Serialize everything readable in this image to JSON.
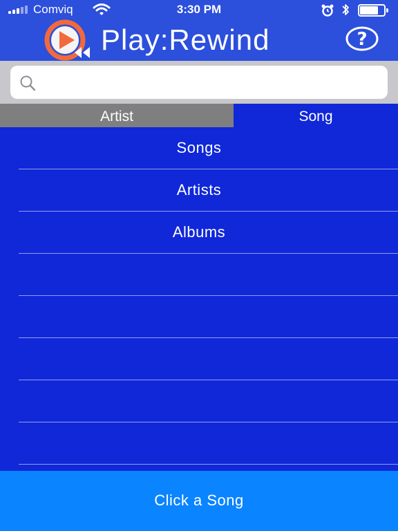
{
  "status_bar": {
    "carrier": "Comviq",
    "time": "3:30 PM",
    "battery_level": 0.75
  },
  "header": {
    "title": "Play:Rewind",
    "help_icon": "question-mark-icon",
    "logo_icon": "play-rewind-logo"
  },
  "search": {
    "placeholder": "",
    "value": ""
  },
  "tabs": [
    {
      "label": "Artist",
      "selected": false
    },
    {
      "label": "Song",
      "selected": true
    }
  ],
  "list": {
    "items": [
      {
        "label": "Songs"
      },
      {
        "label": "Artists"
      },
      {
        "label": "Albums"
      },
      {
        "label": ""
      },
      {
        "label": ""
      },
      {
        "label": ""
      },
      {
        "label": ""
      },
      {
        "label": ""
      }
    ]
  },
  "bottom_button": {
    "label": "Click a Song"
  },
  "colors": {
    "header_bg": "#2c4fdc",
    "list_bg": "#1028d8",
    "bottom_bg": "#0a84ff",
    "tab_inactive_bg": "#7f7f7f",
    "logo_orange": "#f26a3c"
  }
}
